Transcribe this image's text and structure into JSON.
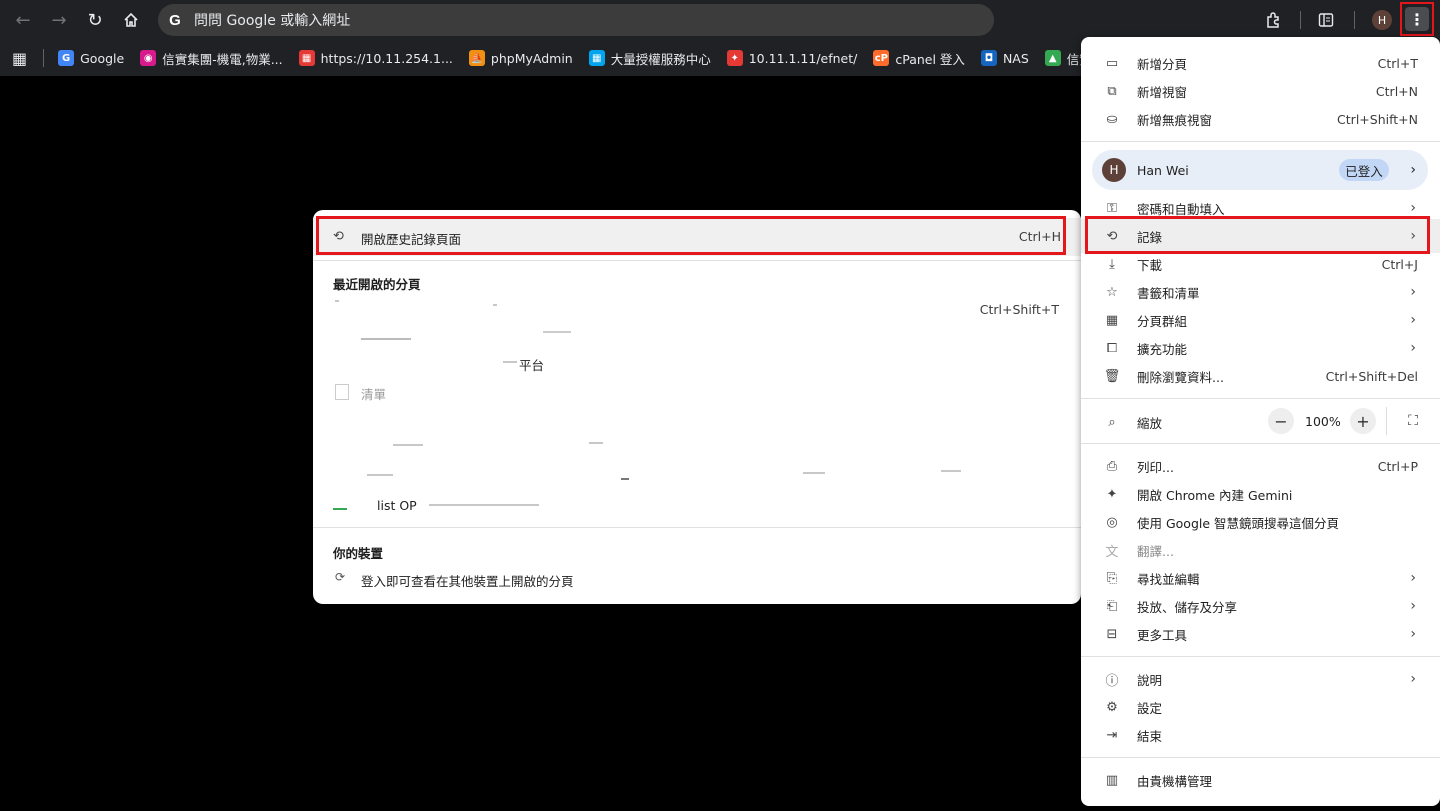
{
  "toolbar": {
    "omnibox_text": "問問 Google 或輸入網址",
    "profile_initial": "H"
  },
  "bookmarks": [
    {
      "label": "Google",
      "color": "#4285f4",
      "glyph": "G"
    },
    {
      "label": "信實集團-機電,物業...",
      "color": "#d81b8c",
      "glyph": "◉"
    },
    {
      "label": "https://10.11.254.1...",
      "color": "#e53935",
      "glyph": "▦"
    },
    {
      "label": "phpMyAdmin",
      "color": "#f29111",
      "glyph": "⛵"
    },
    {
      "label": "大量授權服務中心",
      "color": "#00a4ef",
      "glyph": "▦"
    },
    {
      "label": "10.11.1.11/efnet/",
      "color": "#e53935",
      "glyph": "✦"
    },
    {
      "label": "cPanel 登入",
      "color": "#ff6c2c",
      "glyph": "cP"
    },
    {
      "label": "NAS",
      "color": "#1565c0",
      "glyph": "◘"
    },
    {
      "label": "信實資訊室",
      "color": "#34a853",
      "glyph": "▲"
    }
  ],
  "menu": {
    "new_tab": {
      "label": "新增分頁",
      "shortcut": "Ctrl+T"
    },
    "new_window": {
      "label": "新增視窗",
      "shortcut": "Ctrl+N"
    },
    "incognito": {
      "label": "新增無痕視窗",
      "shortcut": "Ctrl+Shift+N"
    },
    "profile": {
      "name": "Han Wei",
      "initial": "H",
      "status": "已登入"
    },
    "passwords": {
      "label": "密碼和自動填入"
    },
    "history": {
      "label": "記錄"
    },
    "downloads": {
      "label": "下載",
      "shortcut": "Ctrl+J"
    },
    "bookmarks": {
      "label": "書籤和清單"
    },
    "tab_groups": {
      "label": "分頁群組"
    },
    "extensions": {
      "label": "擴充功能"
    },
    "clear_data": {
      "label": "刪除瀏覽資料...",
      "shortcut": "Ctrl+Shift+Del"
    },
    "zoom": {
      "label": "縮放",
      "value": "100%"
    },
    "print": {
      "label": "列印...",
      "shortcut": "Ctrl+P"
    },
    "gemini": {
      "label": "開啟 Chrome 內建 Gemini"
    },
    "lens": {
      "label": "使用 Google 智慧鏡頭搜尋這個分頁"
    },
    "translate": {
      "label": "翻譯..."
    },
    "find_edit": {
      "label": "尋找並編輯"
    },
    "cast_save_share": {
      "label": "投放、儲存及分享"
    },
    "more_tools": {
      "label": "更多工具"
    },
    "help": {
      "label": "說明"
    },
    "settings": {
      "label": "設定"
    },
    "exit": {
      "label": "結束"
    },
    "managed": {
      "label": "由貴機構管理"
    }
  },
  "history_submenu": {
    "open_history": {
      "label": "開啟歷史記錄頁面",
      "shortcut": "Ctrl+H"
    },
    "recent_header": "最近開啟的分頁",
    "reopen_shortcut": "Ctrl+Shift+T",
    "fragments": [
      "平台",
      "清單"
    ],
    "partial_item": "list OP",
    "devices_header": "你的裝置",
    "sign_in_hint": "登入即可查看在其他裝置上開啟的分頁"
  }
}
